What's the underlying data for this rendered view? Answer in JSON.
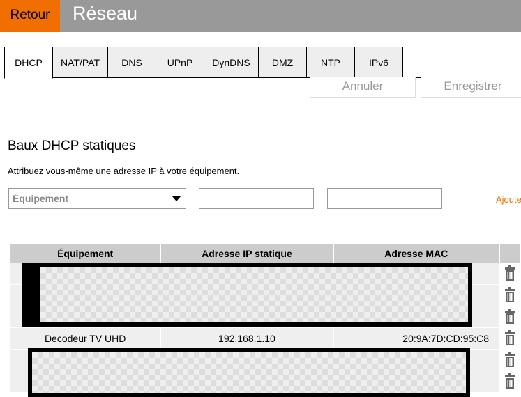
{
  "header": {
    "back_label": "Retour",
    "title": "Réseau"
  },
  "tabs": [
    {
      "label": "DHCP"
    },
    {
      "label": "NAT/PAT"
    },
    {
      "label": "DNS"
    },
    {
      "label": "UPnP"
    },
    {
      "label": "DynDNS"
    },
    {
      "label": "DMZ"
    },
    {
      "label": "NTP"
    },
    {
      "label": "IPv6"
    }
  ],
  "actions": {
    "cancel": "Annuler",
    "save": "Enregistrer"
  },
  "section": {
    "title": "Baux DHCP statiques",
    "description": "Attribuez vous-même une adresse IP à votre équipement.",
    "device_placeholder": "Équipement",
    "add_label": "Ajouter"
  },
  "table": {
    "headers": [
      "Équipement",
      "Adresse IP statique",
      "Adresse MAC"
    ],
    "rows": [
      {
        "device": "",
        "ip": "",
        "mac": ""
      },
      {
        "device": "",
        "ip": "",
        "mac": ""
      },
      {
        "device": "",
        "ip": "",
        "mac": ""
      },
      {
        "device": "Decodeur TV UHD",
        "ip": "192.168.1.10",
        "mac": "20:9A:7D:CD:95:C8"
      },
      {
        "device": "",
        "ip": "",
        "mac": ""
      },
      {
        "device": "",
        "ip": "",
        "mac": ""
      }
    ]
  }
}
